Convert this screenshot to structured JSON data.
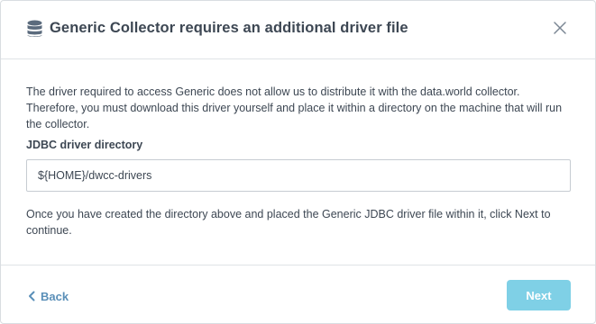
{
  "dialog": {
    "title": "Generic Collector requires an additional driver file",
    "title_icon": "database-icon",
    "close_icon": "close-icon"
  },
  "content": {
    "description": "The driver required to access Generic does not allow us to distribute it with the data.world collector. Therefore, you must download this driver yourself and place it within a directory on the machine that will run the collector.",
    "field_label": "JDBC driver directory",
    "field_value": "${HOME}/dwcc-drivers",
    "note": "Once you have created the directory above and placed the Generic JDBC driver file within it, click Next to continue."
  },
  "footer": {
    "back_label": "Back",
    "back_icon": "chevron-left-icon",
    "next_label": "Next"
  },
  "colors": {
    "text": "#3d4753",
    "link": "#5a8fb8",
    "primary_button": "#7fd0e6",
    "border": "#c6ccd2",
    "icon": "#5b6b7d"
  }
}
